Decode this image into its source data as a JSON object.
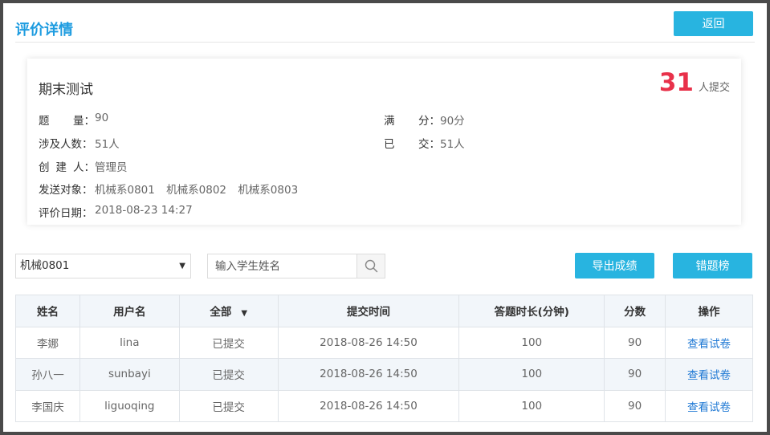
{
  "header": {
    "title": "评价详情",
    "back_label": "返回"
  },
  "exam": {
    "name": "期末测试",
    "submit_count": "31",
    "submit_unit": "人提交",
    "question_count_label_a": "题",
    "question_count_label_b": "量",
    "question_count": "90",
    "full_score_label_a": "满",
    "full_score_label_b": "分",
    "full_score": "90分",
    "involved_label": "涉及人数",
    "involved": "51人",
    "submitted_label_a": "已",
    "submitted_label_b": "交",
    "submitted": "51人",
    "creator_label_a": "创",
    "creator_label_b": "建",
    "creator_label_c": "人",
    "creator": "管理员",
    "targets_label": "发送对象",
    "targets": [
      "机械系0801",
      "机械系0802",
      "机械系0803"
    ],
    "date_label": "评价日期",
    "date": "2018-08-23 14:27",
    "colon": "："
  },
  "filters": {
    "class_selected": "机械0801",
    "search_placeholder": "输入学生姓名",
    "export_label": "导出成绩",
    "wrong_label": "错题榜"
  },
  "table": {
    "headers": {
      "name": "姓名",
      "username": "用户名",
      "status": "全部",
      "submit_time": "提交时间",
      "duration": "答题时长(分钟)",
      "score": "分数",
      "action": "操作"
    },
    "rows": [
      {
        "name": "李娜",
        "username": "lina",
        "status": "已提交",
        "submit_time": "2018-08-26 14:50",
        "duration": "100",
        "score": "90",
        "action": "查看试卷"
      },
      {
        "name": "孙八一",
        "username": "sunbayi",
        "status": "已提交",
        "submit_time": "2018-08-26 14:50",
        "duration": "100",
        "score": "90",
        "action": "查看试卷"
      },
      {
        "name": "李国庆",
        "username": "liguoqing",
        "status": "已提交",
        "submit_time": "2018-08-26 14:50",
        "duration": "100",
        "score": "90",
        "action": "查看试卷"
      }
    ]
  },
  "colors": {
    "accent": "#28b4e0",
    "title": "#1e9ce0",
    "count": "#e8314a",
    "link": "#1e78d4"
  }
}
